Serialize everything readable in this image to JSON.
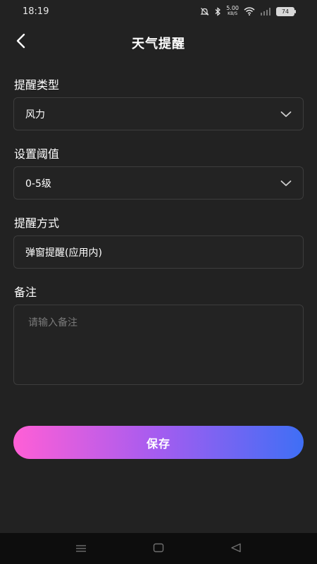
{
  "status_bar": {
    "time": "18:19",
    "net_speed_value": "5.00",
    "net_speed_unit": "KB/S",
    "battery": "74"
  },
  "header": {
    "title": "天气提醒"
  },
  "form": {
    "reminder_type": {
      "label": "提醒类型",
      "value": "风力"
    },
    "threshold": {
      "label": "设置阈值",
      "value": "0-5级"
    },
    "method": {
      "label": "提醒方式",
      "value": "弹窗提醒(应用内)"
    },
    "note": {
      "label": "备注",
      "value": "",
      "placeholder": "请输入备注"
    }
  },
  "actions": {
    "save_label": "保存"
  },
  "icons": {
    "back": "back-arrow-icon",
    "dropdown": "chevron-down-icon",
    "nav_menu": "menu-icon",
    "nav_home": "home-icon",
    "nav_back": "back-triangle-icon"
  },
  "colors": {
    "background": "#222222",
    "field_border": "#3d3d3d",
    "gradient_start": "#ff5fd6",
    "gradient_mid": "#a45cf0",
    "gradient_end": "#3f6ff5",
    "nav_bar": "#0d0d0d"
  }
}
